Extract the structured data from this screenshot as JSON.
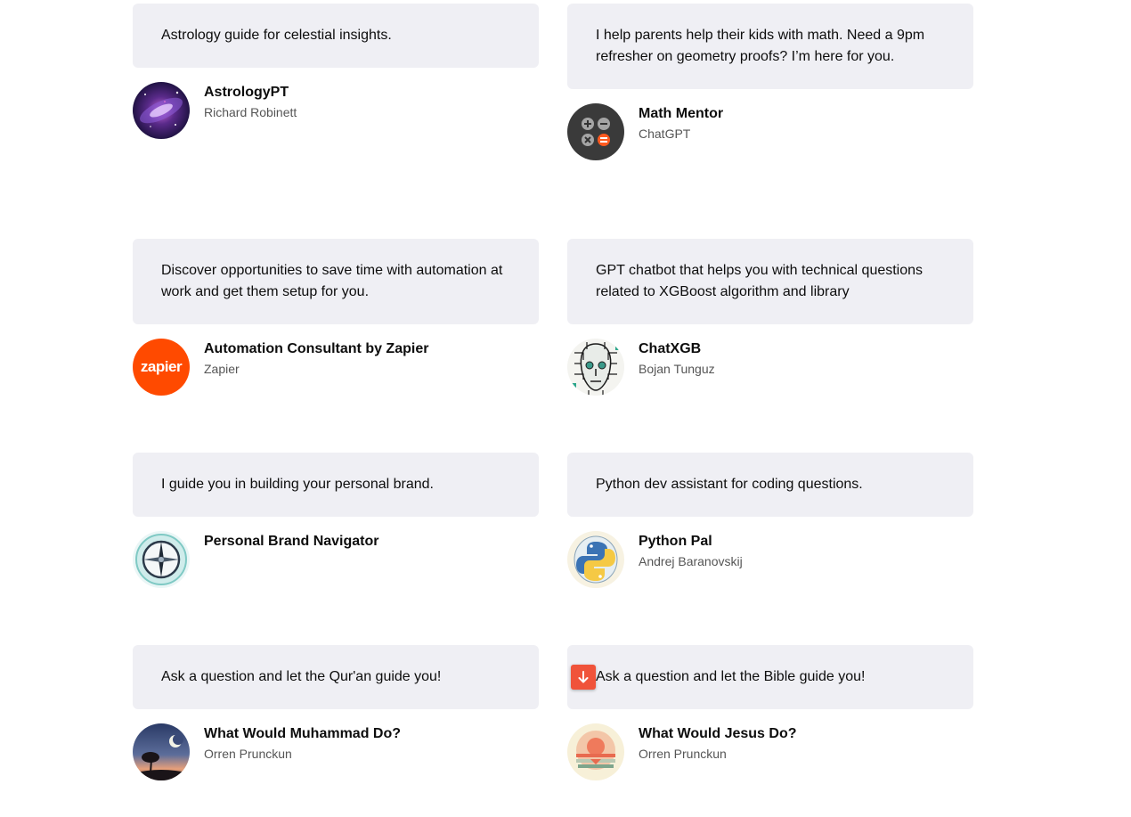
{
  "cards": [
    {
      "description": "Astrology guide for celestial insights.",
      "name": "AstrologyPT",
      "author": "Richard Robinett",
      "avatar_icon": "galaxy-icon"
    },
    {
      "description": "I help parents help their kids with math. Need a 9pm refresher on geometry proofs? I’m here for you.",
      "name": "Math Mentor",
      "author": "ChatGPT",
      "avatar_icon": "calculator-icon"
    },
    {
      "description": "Discover opportunities to save time with automation at work and get them setup for you.",
      "name": "Automation Consultant by Zapier",
      "author": "Zapier",
      "avatar_icon": "zapier-logo",
      "avatar_text": "zapier"
    },
    {
      "description": "GPT chatbot that helps you with technical questions related to XGBoost algorithm and library",
      "name": "ChatXGB",
      "author": "Bojan Tunguz",
      "avatar_icon": "circuit-face-icon"
    },
    {
      "description": "I guide you in building your personal brand.",
      "name": "Personal Brand Navigator",
      "author": "",
      "avatar_icon": "compass-icon"
    },
    {
      "description": "Python dev assistant for coding questions.",
      "name": "Python Pal",
      "author": "Andrej Baranovskij",
      "avatar_icon": "python-brain-icon"
    },
    {
      "description": "Ask a question and let the Qur'an guide you!",
      "name": "What Would Muhammad Do?",
      "author": "Orren Prunckun",
      "avatar_icon": "crescent-moon-tree-icon"
    },
    {
      "description": "Ask a question and let the Bible guide you!",
      "name": "What Would Jesus Do?",
      "author": "Orren Prunckun",
      "avatar_icon": "sunset-icon"
    }
  ],
  "colors": {
    "bubble_bg": "#efeff4",
    "zapier_orange": "#ff4a00",
    "overlay_button": "#f0533a"
  },
  "overlay_button_icon": "arrow-down-icon"
}
